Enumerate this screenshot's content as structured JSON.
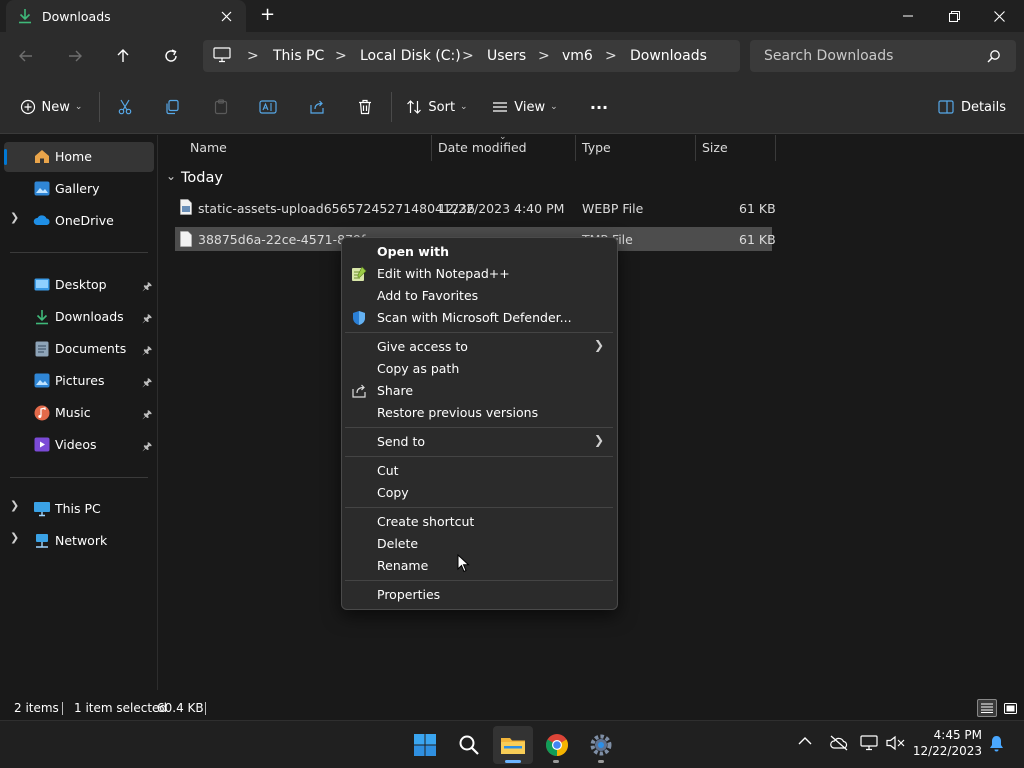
{
  "window": {
    "tab_title": "Downloads",
    "new_tab": "+"
  },
  "address": {
    "crumbs": [
      "This PC",
      "Local Disk (C:)",
      "Users",
      "vm6",
      "Downloads"
    ],
    "search_placeholder": "Search Downloads"
  },
  "toolbar": {
    "new_label": "New",
    "sort_label": "Sort",
    "view_label": "View",
    "more_label": "···",
    "details_label": "Details"
  },
  "sidebar": {
    "home": "Home",
    "gallery": "Gallery",
    "onedrive": "OneDrive",
    "quick": [
      {
        "label": "Desktop"
      },
      {
        "label": "Downloads"
      },
      {
        "label": "Documents"
      },
      {
        "label": "Pictures"
      },
      {
        "label": "Music"
      },
      {
        "label": "Videos"
      }
    ],
    "thispc": "This PC",
    "network": "Network"
  },
  "files": {
    "columns": {
      "name": "Name",
      "date": "Date modified",
      "type": "Type",
      "size": "Size"
    },
    "group": "Today",
    "rows": [
      {
        "name": "static-assets-upload6565724527148041236",
        "date": "12/22/2023 4:40 PM",
        "type": "WEBP File",
        "size": "61 KB"
      },
      {
        "name": "38875d6a-22ce-4571-879f-c",
        "date": "",
        "type": "TMP File",
        "size": "61 KB"
      }
    ]
  },
  "context_menu": {
    "open_with": "Open with",
    "edit_notepad": "Edit with Notepad++",
    "add_favorites": "Add to Favorites",
    "scan_defender": "Scan with Microsoft Defender...",
    "give_access": "Give access to",
    "copy_path": "Copy as path",
    "share": "Share",
    "restore": "Restore previous versions",
    "send_to": "Send to",
    "cut": "Cut",
    "copy": "Copy",
    "create_shortcut": "Create shortcut",
    "delete": "Delete",
    "rename": "Rename",
    "properties": "Properties"
  },
  "status": {
    "items": "2 items",
    "selected": "1 item selected",
    "size": "60.4 KB"
  },
  "taskbar": {
    "time": "4:45 PM",
    "date": "12/22/2023"
  },
  "colors": {
    "accent": "#0078d4",
    "background": "#191919",
    "selection": "#4d4d4d",
    "menu": "#2b2b2b"
  }
}
